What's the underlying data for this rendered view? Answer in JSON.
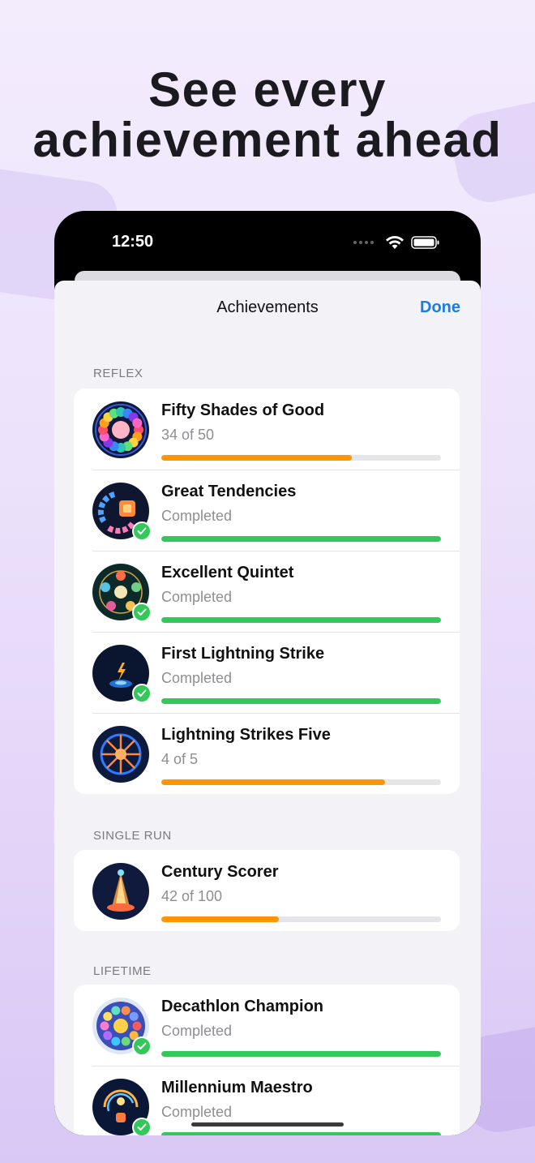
{
  "headline": {
    "line1": "See every",
    "line2": "achievement ahead"
  },
  "status_bar": {
    "time": "12:50"
  },
  "nav": {
    "title": "Achievements",
    "done_label": "Done"
  },
  "colors": {
    "accent": "#1a7de6",
    "progress": "#ff9500",
    "complete": "#34c759"
  },
  "sections": [
    {
      "header": "REFLEX",
      "items": [
        {
          "title": "Fifty Shades of Good",
          "subtitle": "34 of 50",
          "progress": 0.68,
          "completed": false,
          "icon": "color-wheel-icon"
        },
        {
          "title": "Great Tendencies",
          "subtitle": "Completed",
          "progress": 1.0,
          "completed": true,
          "icon": "tile-streak-icon"
        },
        {
          "title": "Excellent Quintet",
          "subtitle": "Completed",
          "progress": 1.0,
          "completed": true,
          "icon": "five-orbs-icon"
        },
        {
          "title": "First Lightning Strike",
          "subtitle": "Completed",
          "progress": 1.0,
          "completed": true,
          "icon": "lightning-icon"
        },
        {
          "title": "Lightning Strikes Five",
          "subtitle": "4 of 5",
          "progress": 0.8,
          "completed": false,
          "icon": "lightning-wheel-icon"
        }
      ]
    },
    {
      "header": "SINGLE RUN",
      "items": [
        {
          "title": "Century Scorer",
          "subtitle": "42 of 100",
          "progress": 0.42,
          "completed": false,
          "icon": "glowing-tower-icon"
        }
      ]
    },
    {
      "header": "LIFETIME",
      "items": [
        {
          "title": "Decathlon Champion",
          "subtitle": "Completed",
          "progress": 1.0,
          "completed": true,
          "icon": "medal-wheel-icon"
        },
        {
          "title": "Millennium Maestro",
          "subtitle": "Completed",
          "progress": 1.0,
          "completed": true,
          "icon": "swirl-orb-icon"
        }
      ]
    }
  ]
}
